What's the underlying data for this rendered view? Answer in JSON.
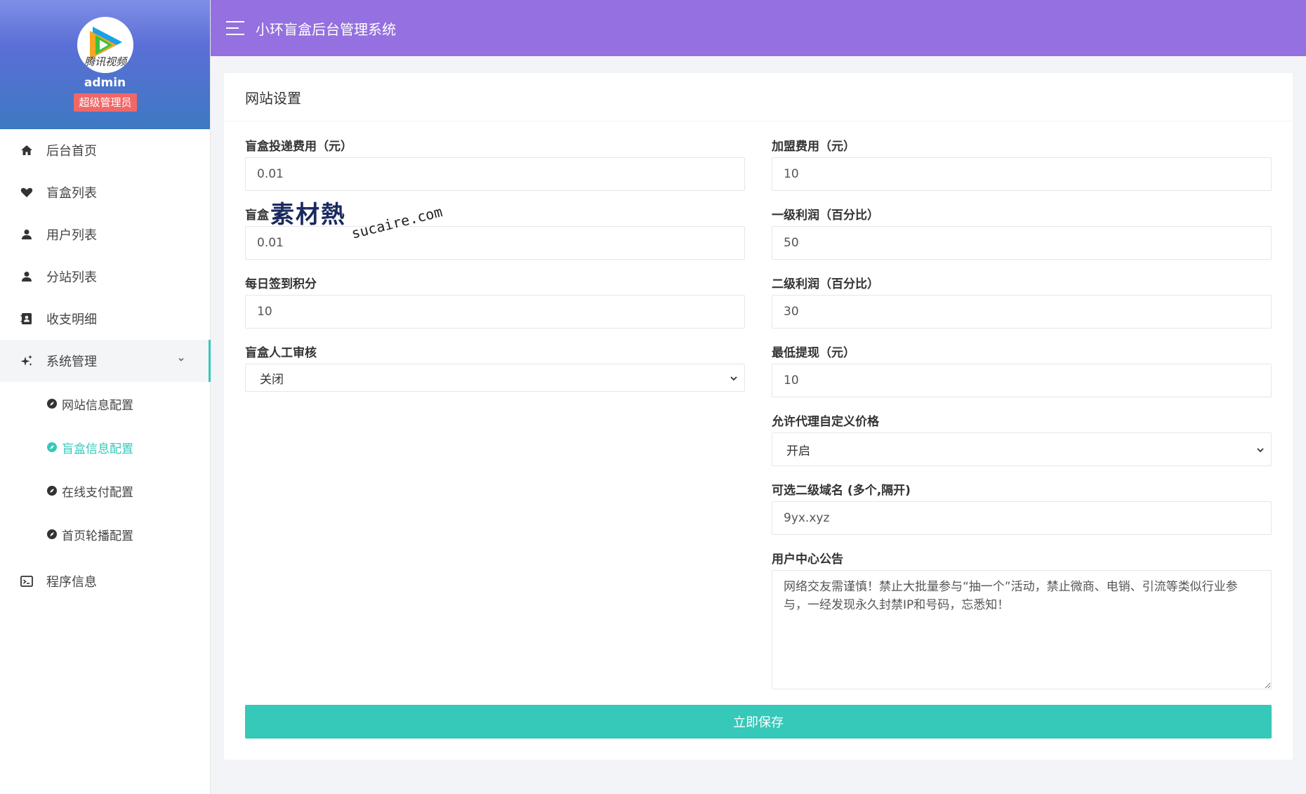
{
  "sidebar": {
    "avatar_text": "腾讯视频",
    "username": "admin",
    "role": "超级管理员",
    "menu": [
      {
        "label": "后台首页",
        "icon": "home-icon"
      },
      {
        "label": "盲盒列表",
        "icon": "heart-icon"
      },
      {
        "label": "用户列表",
        "icon": "user-icon"
      },
      {
        "label": "分站列表",
        "icon": "user-icon"
      },
      {
        "label": "收支明细",
        "icon": "contact-book-icon"
      },
      {
        "label": "系统管理",
        "icon": "sparkle-icon"
      }
    ],
    "submenu": [
      {
        "label": "网站信息配置",
        "icon": "compass-icon"
      },
      {
        "label": "盲盒信息配置",
        "icon": "compass-icon"
      },
      {
        "label": "在线支付配置",
        "icon": "compass-icon"
      },
      {
        "label": "首页轮播配置",
        "icon": "compass-icon"
      }
    ],
    "footer_item": {
      "label": "程序信息",
      "icon": "terminal-icon"
    }
  },
  "topbar": {
    "title": "小环盲盒后台管理系统"
  },
  "card": {
    "title": "网站设置"
  },
  "form": {
    "left": {
      "delivery_fee": {
        "label": "盲盒投递费用（元）",
        "value": "0.01"
      },
      "second_fee": {
        "label": "盲盒",
        "value": "0.01"
      },
      "daily_checkin": {
        "label": "每日签到积分",
        "value": "10"
      },
      "manual_review": {
        "label": "盲盒人工审核",
        "value": "关闭"
      }
    },
    "right": {
      "franchise_fee": {
        "label": "加盟费用（元）",
        "value": "10"
      },
      "level1_profit": {
        "label": "一级利润（百分比）",
        "value": "50"
      },
      "level2_profit": {
        "label": "二级利润（百分比）",
        "value": "30"
      },
      "min_withdraw": {
        "label": "最低提现（元）",
        "value": "10"
      },
      "agent_custom_price": {
        "label": "允许代理自定义价格",
        "value": "开启"
      },
      "subdomains": {
        "label": "可选二级域名 (多个,隔开)",
        "value": "9yx.xyz"
      },
      "notice": {
        "label": "用户中心公告",
        "value": "网络交友需谨慎！禁止大批量参与“抽一个”活动，禁止微商、电销、引流等类似行业参与，一经发现永久封禁IP和号码，忘悉知！"
      }
    },
    "save_label": "立即保存"
  },
  "watermark": {
    "main": "素材熱",
    "sub": "sucaire.com"
  },
  "colors": {
    "topbar": "#9570e0",
    "accent": "#36c8b9",
    "badge": "#f06767"
  }
}
